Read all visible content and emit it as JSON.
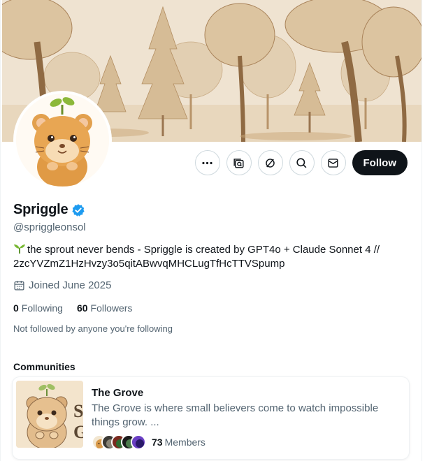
{
  "profile": {
    "display_name": "Spriggle",
    "handle": "@spriggleonsol",
    "bio_text": "the sprout never bends - Spriggle is created by GPT4o + Claude Sonnet 4 // 2zcYVZmZ1HzHvzy3o5qitABwvqMHCLugTfHcTTVSpump",
    "joined": "Joined June 2025",
    "following_count": "0",
    "following_label": "Following",
    "followers_count": "60",
    "followers_label": "Followers",
    "not_followed_note": "Not followed by anyone you're following"
  },
  "actions": {
    "follow_label": "Follow",
    "icons": [
      "more-icon",
      "grok-icon",
      "subscribe-icon",
      "search-icon",
      "message-icon"
    ]
  },
  "communities": {
    "title": "Communities",
    "items": [
      {
        "name": "The Grove",
        "description": "The Grove is where small believers come to watch impossible things grow. ...",
        "member_count": "73",
        "member_label": "Members"
      }
    ]
  },
  "colors": {
    "follow_bg": "#0f1419",
    "verified": "#1d9bf0",
    "secondary_text": "#536471",
    "banner_base": "#efe2cf"
  }
}
